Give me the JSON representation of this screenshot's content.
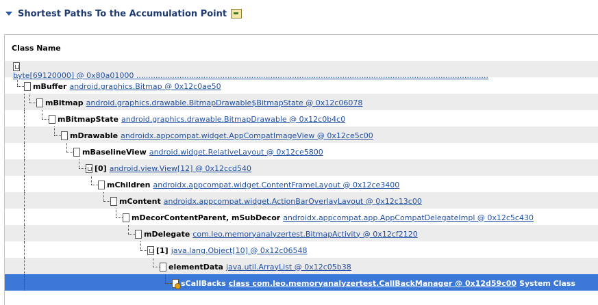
{
  "header": {
    "title": "Shortest Paths To the Accumulation Point"
  },
  "table": {
    "column_header": "Class Name",
    "rows": [
      {
        "label": "",
        "link": "byte[69120000] @ 0x80a01000 ...................................................................................................................................................",
        "extra": "",
        "icon": "array"
      },
      {
        "label": "mBuffer",
        "link": "android.graphics.Bitmap @ 0x12c0ae50",
        "extra": "",
        "icon": "file"
      },
      {
        "label": "mBitmap",
        "link": "android.graphics.drawable.BitmapDrawable$BitmapState @ 0x12c06078",
        "extra": "",
        "icon": "file"
      },
      {
        "label": "mBitmapState",
        "link": "android.graphics.drawable.BitmapDrawable @ 0x12c0b4c0",
        "extra": "",
        "icon": "file"
      },
      {
        "label": "mDrawable",
        "link": "androidx.appcompat.widget.AppCompatImageView @ 0x12ce5c00",
        "extra": "",
        "icon": "file"
      },
      {
        "label": "mBaselineView",
        "link": "android.widget.RelativeLayout @ 0x12ce5800",
        "extra": "",
        "icon": "file"
      },
      {
        "label": "[0]",
        "link": "android.view.View[12] @ 0x12ccd540",
        "extra": "",
        "icon": "array"
      },
      {
        "label": "mChildren",
        "link": "androidx.appcompat.widget.ContentFrameLayout @ 0x12ce3400",
        "extra": "",
        "icon": "file"
      },
      {
        "label": "mContent",
        "link": "androidx.appcompat.widget.ActionBarOverlayLayout @ 0x12c13c00",
        "extra": "",
        "icon": "file"
      },
      {
        "label": "mDecorContentParent, mSubDecor",
        "link": "androidx.appcompat.app.AppCompatDelegateImpl @ 0x12c5c430",
        "extra": "",
        "icon": "file"
      },
      {
        "label": "mDelegate",
        "link": "com.leo.memoryanalyzertest.BitmapActivity @ 0x12cf2120",
        "extra": "",
        "icon": "file"
      },
      {
        "label": "[1]",
        "link": "java.lang.Object[10] @ 0x12c06548",
        "extra": "",
        "icon": "array"
      },
      {
        "label": "elementData",
        "link": "java.util.ArrayList @ 0x12c05b38",
        "extra": "",
        "icon": "file"
      },
      {
        "label": "sCallBacks",
        "link": "class com.leo.memoryanalyzertest.CallBackManager @ 0x12d59c00",
        "extra": "System Class",
        "icon": "class"
      }
    ]
  }
}
